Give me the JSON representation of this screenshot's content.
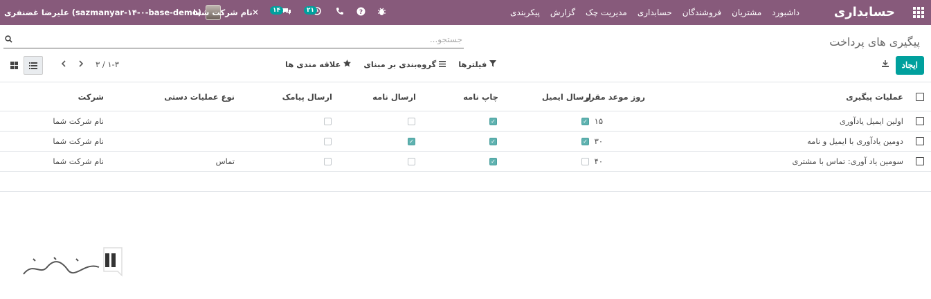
{
  "navbar": {
    "app_title": "حسابداری",
    "menu": [
      "داشبورد",
      "مشتریان",
      "فروشندگان",
      "حسابداری",
      "مدیریت چک",
      "گزارش",
      "پیکربندی"
    ],
    "company": "نام شرکت شما",
    "user": "علیرضا غضنفری (sazmanyar-۱۴-۰-base-demo)",
    "badges": {
      "messages": "۱۴",
      "activities": "۲۱"
    }
  },
  "control_panel": {
    "breadcrumb": "پیگیری های پرداخت",
    "search_placeholder": "جستجو...",
    "create_label": "ایجاد",
    "filters_label": "فیلترها",
    "group_by_label": "گروه‌بندی بر مبنای",
    "favorites_label": "علاقه مندی ها",
    "pager_value": "۱-۳ / ۳"
  },
  "table": {
    "columns": [
      "عملیات پیگیری",
      "روز موعد مقرر",
      "ارسال ایمیل",
      "چاپ نامه",
      "ارسال نامه",
      "ارسال پیامک",
      "نوع عملیات دستی",
      "شرکت"
    ],
    "rows": [
      {
        "name": "اولین ایمیل یادآوری",
        "days": "۱۵",
        "send_email": true,
        "print_letter": true,
        "send_letter": false,
        "send_sms": false,
        "manual_type": "",
        "company": "نام شرکت شما"
      },
      {
        "name": "دومین یادآوری با ایمیل و نامه",
        "days": "۳۰",
        "send_email": true,
        "print_letter": true,
        "send_letter": true,
        "send_sms": false,
        "manual_type": "",
        "company": "نام شرکت شما"
      },
      {
        "name": "سومین یاد آوری: تماس با مشتری",
        "days": "۴۰",
        "send_email": false,
        "print_letter": true,
        "send_letter": false,
        "send_sms": false,
        "manual_type": "تماس",
        "company": "نام شرکت شما"
      }
    ]
  }
}
